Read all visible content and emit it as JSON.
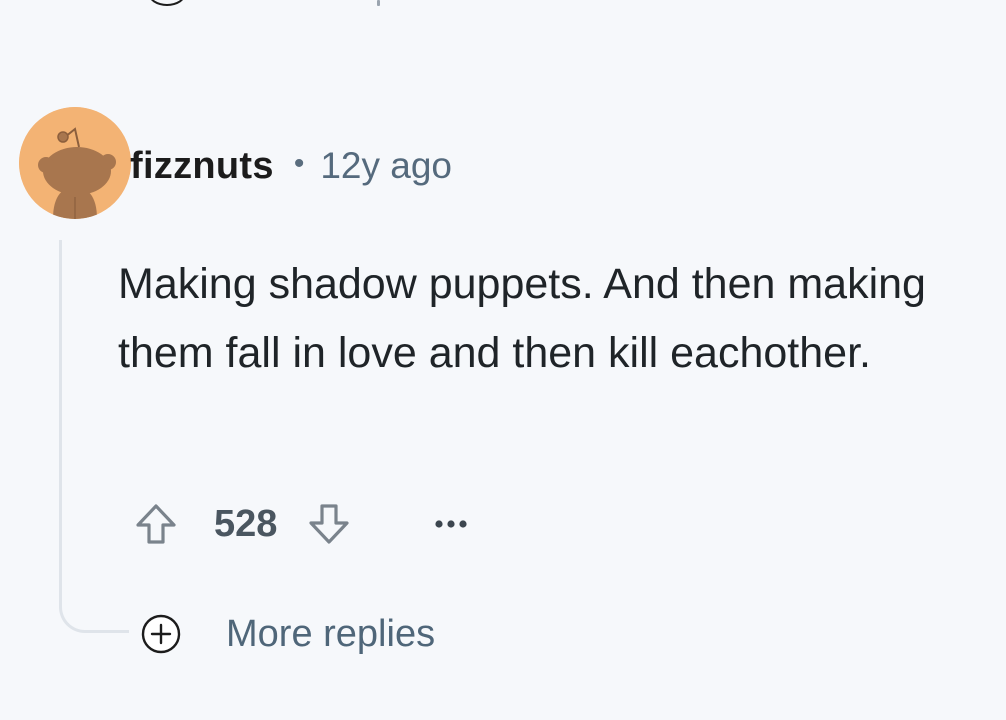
{
  "comment": {
    "author": "fizznuts",
    "separator": "•",
    "timestamp": "12y ago",
    "body": "Making shadow puppets. And then making them fall in love and then kill eachother.",
    "score": "528"
  },
  "actions": {
    "upvote_icon": "arrow-up-outline-icon",
    "downvote_icon": "arrow-down-outline-icon",
    "more_icon": "ellipsis-icon"
  },
  "thread": {
    "more_replies_label": "More replies",
    "more_replies_icon": "plus-circle-icon"
  },
  "colors": {
    "background": "#f6f8fb",
    "avatar_bg": "#f3b374",
    "avatar_figure": "#a8764e",
    "meta_text": "#556a7d",
    "thread_line": "#dfe4ea"
  }
}
